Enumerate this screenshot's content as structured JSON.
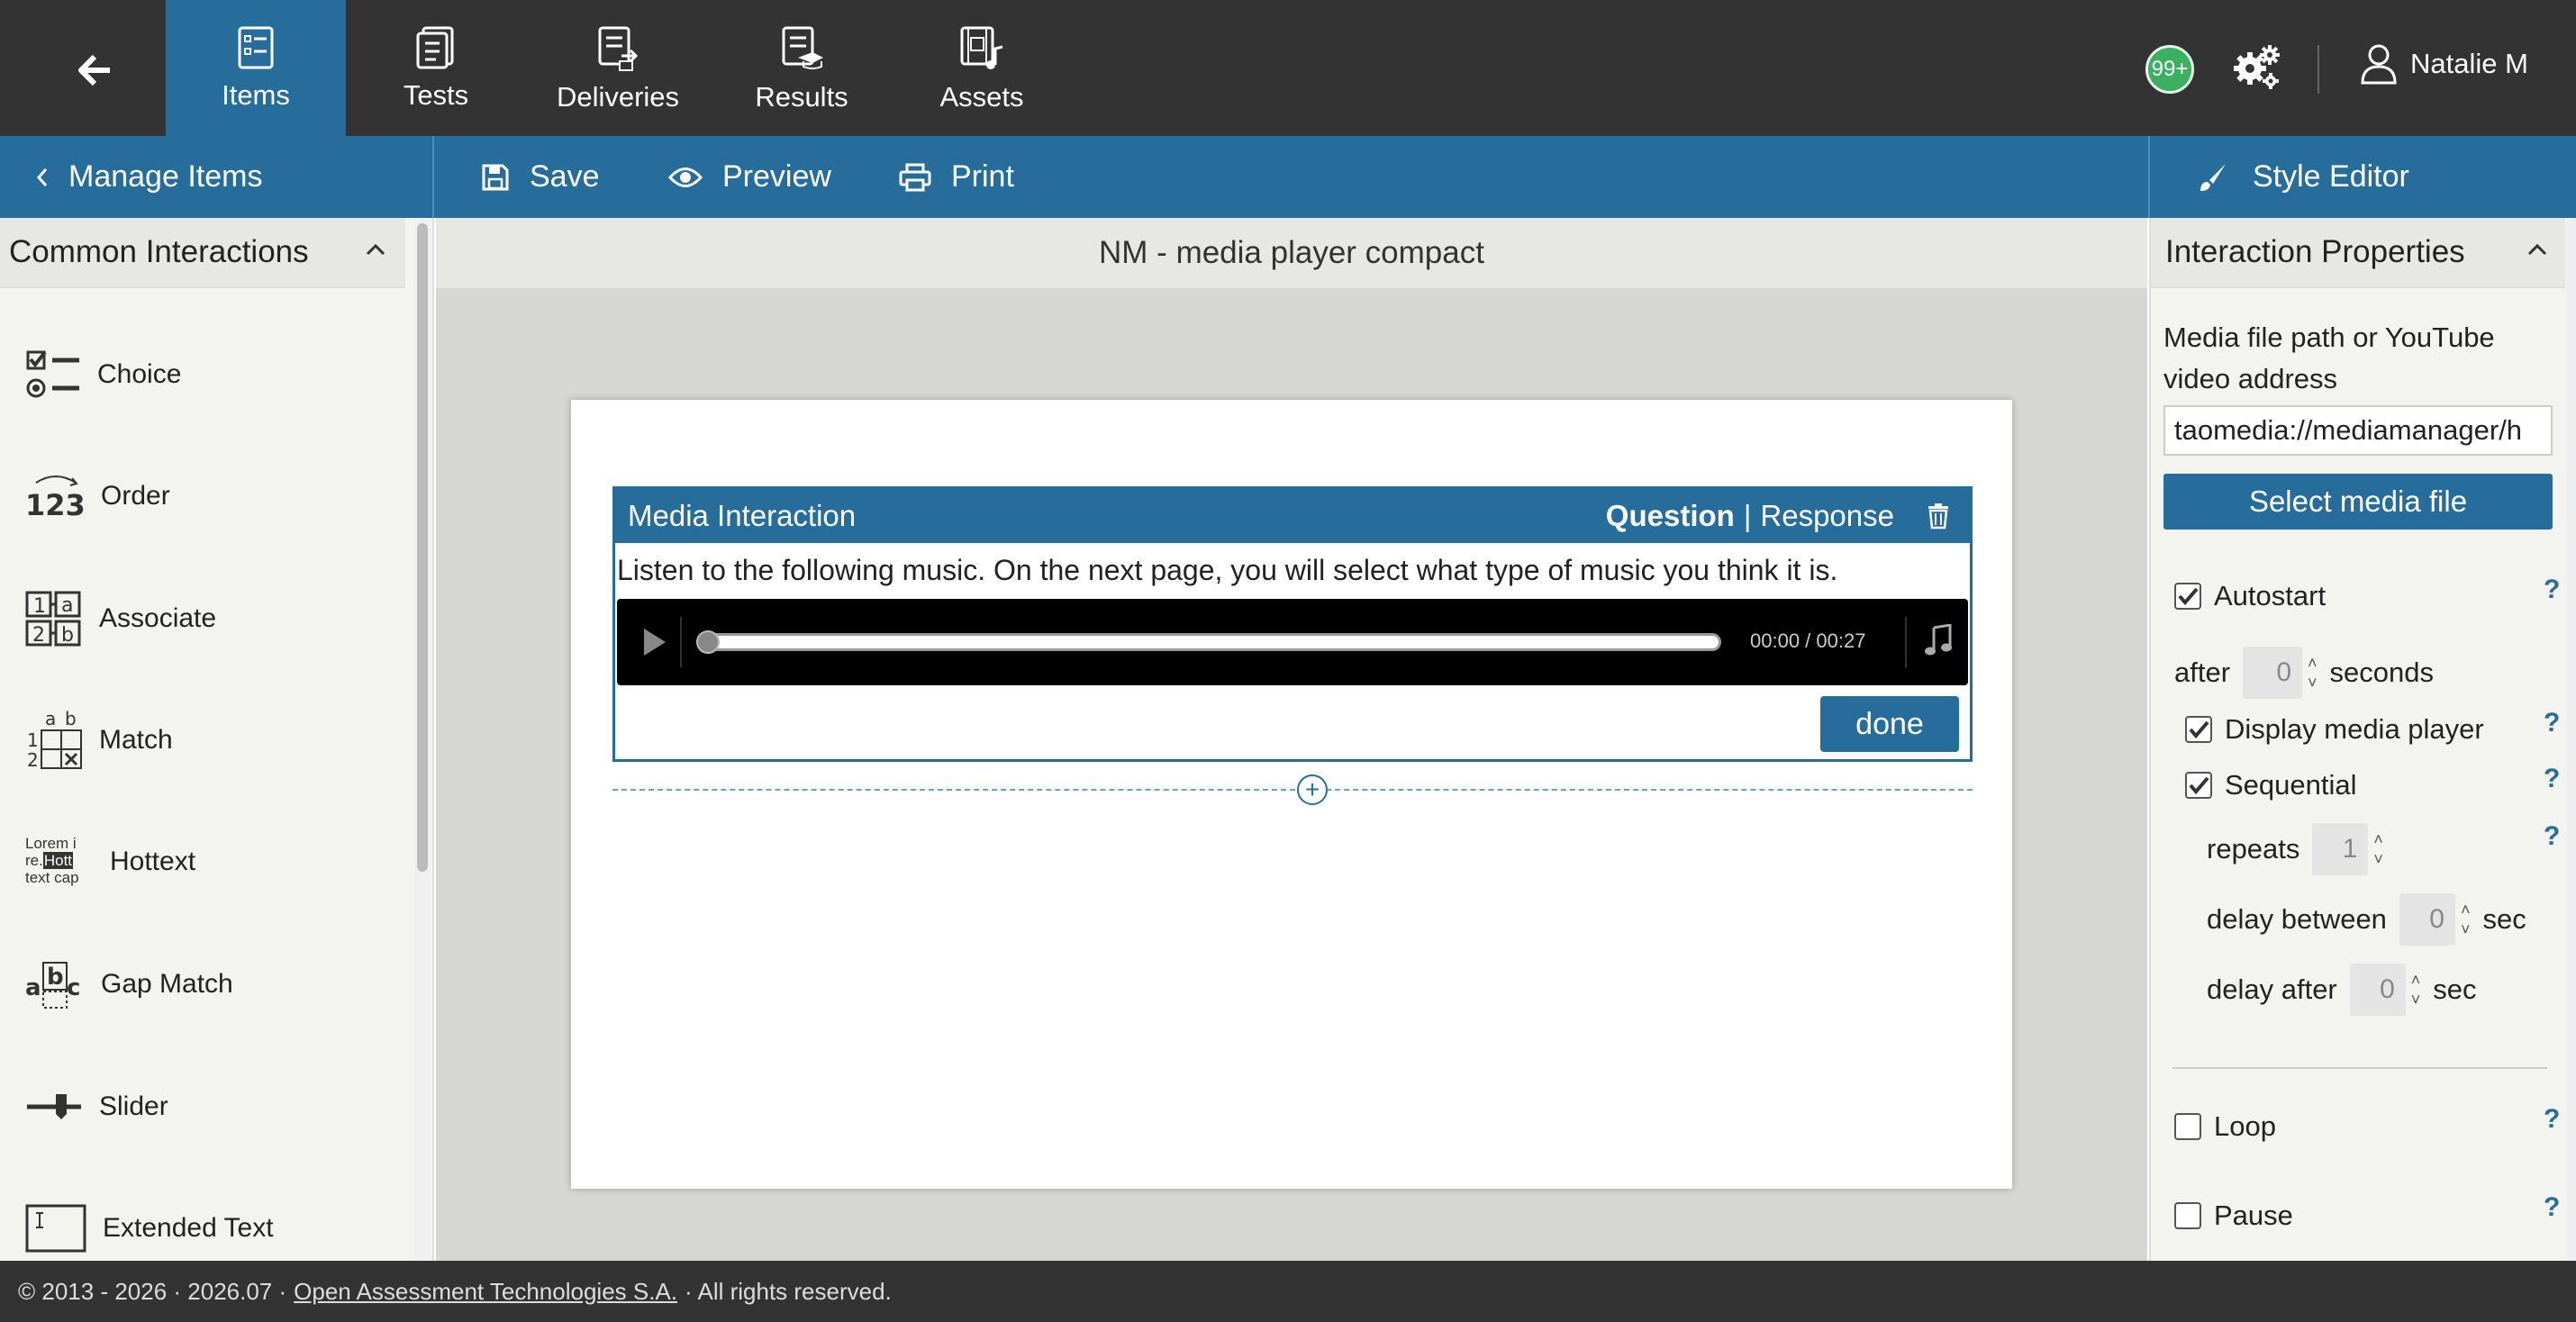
{
  "topnav": {
    "items": [
      {
        "label": "Items",
        "icon": "items-icon",
        "active": true
      },
      {
        "label": "Tests",
        "icon": "tests-icon",
        "active": false
      },
      {
        "label": "Deliveries",
        "icon": "deliveries-icon",
        "active": false
      },
      {
        "label": "Results",
        "icon": "results-icon",
        "active": false
      },
      {
        "label": "Assets",
        "icon": "assets-icon",
        "active": false
      }
    ],
    "notifications_badge": "99+",
    "user_name": "Natalie M"
  },
  "subbar": {
    "manage_items": "Manage Items",
    "save": "Save",
    "preview": "Preview",
    "print": "Print",
    "style_editor": "Style Editor"
  },
  "left_panel": {
    "header": "Common Interactions",
    "items": [
      {
        "label": "Choice",
        "icon": "choice-icon"
      },
      {
        "label": "Order",
        "icon": "order-icon"
      },
      {
        "label": "Associate",
        "icon": "associate-icon"
      },
      {
        "label": "Match",
        "icon": "match-icon"
      },
      {
        "label": "Hottext",
        "icon": "hottext-icon",
        "icon_text": [
          "Lorem i",
          "re.",
          "Hott",
          "text cap"
        ]
      },
      {
        "label": "Gap Match",
        "icon": "gap-match-icon"
      },
      {
        "label": "Slider",
        "icon": "slider-icon"
      },
      {
        "label": "Extended Text",
        "icon": "extended-text-icon"
      }
    ]
  },
  "canvas": {
    "title": "NM - media player compact",
    "interaction": {
      "title": "Media Interaction",
      "tab_question": "Question",
      "tab_separator": "|",
      "tab_response": "Response",
      "prompt": "Listen to the following music. On the next page, you will select what type of music you think it is.",
      "player_time": "00:00 / 00:27",
      "progress": 0,
      "done_label": "done"
    }
  },
  "right_panel": {
    "header": "Interaction Properties",
    "media_label": "Media file path or YouTube video address",
    "media_value": "taomedia://mediamanager/h",
    "select_media": "Select media file",
    "autostart": {
      "label": "Autostart",
      "checked": true
    },
    "after_label": "after",
    "after_value": "0",
    "seconds_label": "seconds",
    "display_player": {
      "label": "Display media player",
      "checked": true
    },
    "sequential": {
      "label": "Sequential",
      "checked": true
    },
    "repeats_label": "repeats",
    "repeats_value": "1",
    "delay_between_label": "delay between",
    "delay_between_value": "0",
    "delay_after_label": "delay after",
    "delay_after_value": "0",
    "sec_label": "sec",
    "loop": {
      "label": "Loop",
      "checked": false
    },
    "pause": {
      "label": "Pause",
      "checked": false
    },
    "help": "?"
  },
  "footer": {
    "prefix": "© 2013 - 2026 · 2026.07 ·",
    "link": "Open Assessment Technologies S.A.",
    "suffix": "· All rights reserved."
  },
  "colors": {
    "topbar": "#333333",
    "accent": "#266d9c",
    "badge": "#3bb061"
  }
}
